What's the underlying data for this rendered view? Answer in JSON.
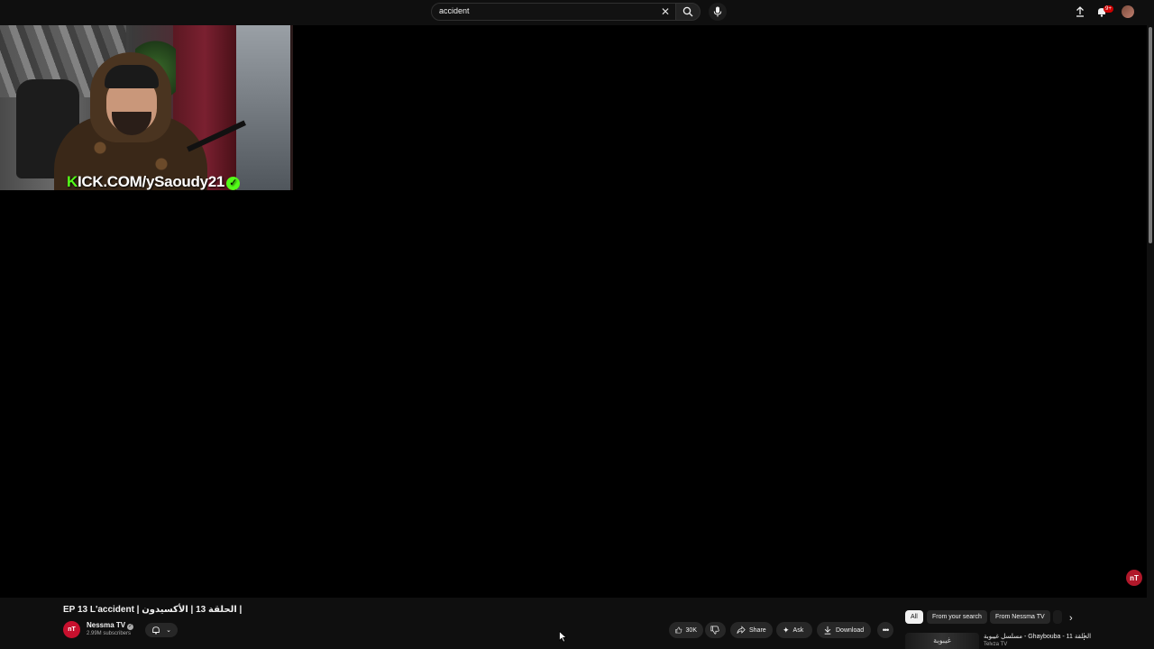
{
  "search": {
    "query": "accident"
  },
  "header": {
    "notification_count": "9+"
  },
  "webcam": {
    "overlay_text_k": "K",
    "overlay_text_rest": "ICK.COM/ySaoudy21"
  },
  "video": {
    "title": "EP 13 L'accident | الحلقة 13 | الأكسيدون |",
    "channel": {
      "name": "Nessma TV",
      "subscribers": "2.99M subscribers",
      "avatar_text": "nT"
    },
    "watermark_text": "nT"
  },
  "actions": {
    "likes": "30K",
    "share_label": "Share",
    "ask_label": "Ask",
    "download_label": "Download"
  },
  "chips": [
    "All",
    "From your search",
    "From Nessma TV"
  ],
  "recommendation": {
    "title": "مسلسل غيبوبة - Ghaybouba - الحلقة 11",
    "channel": "Telvza TV",
    "thumb_text": "غيبوبة"
  },
  "colors": {
    "kick_green": "#53fc18",
    "badge_red": "#cc0000",
    "nessma_red": "#c8102e"
  }
}
